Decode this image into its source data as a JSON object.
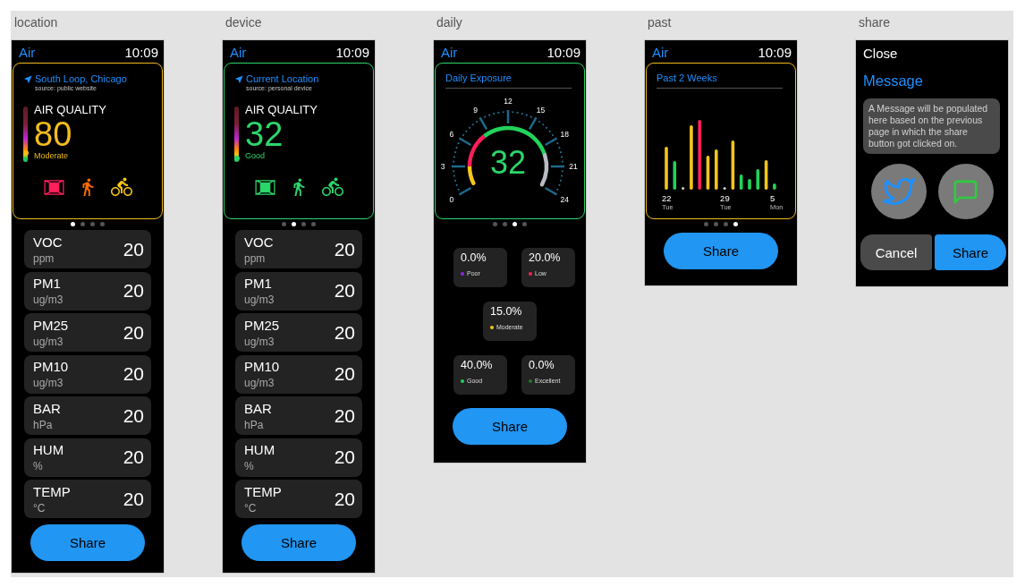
{
  "artboards": [
    {
      "kind": "overview",
      "label": "location",
      "status_bar": {
        "app": "Air",
        "time": "10:09"
      },
      "card": {
        "color": "#f2bc1b",
        "place": "South Loop, Chicago",
        "source": "source: public website",
        "heading": "AIR QUALITY",
        "value": "80",
        "rating": "Moderate",
        "level": 0.16,
        "activities": [
          {
            "kind": "indoor",
            "color": "#ff1f5a"
          },
          {
            "kind": "walk",
            "color": "#ff6a00"
          },
          {
            "kind": "bike",
            "color": "#f5c518"
          }
        ]
      },
      "pages": [
        {
          "selected": true
        },
        {
          "selected": false
        },
        {
          "selected": false
        },
        {
          "selected": false
        }
      ],
      "metrics": [
        {
          "name": "VOC",
          "unit": "ppm",
          "value": "20"
        },
        {
          "name": "PM1",
          "unit": "ug/m3",
          "value": "20"
        },
        {
          "name": "PM25",
          "unit": "ug/m3",
          "value": "20"
        },
        {
          "name": "PM10",
          "unit": "ug/m3",
          "value": "20"
        },
        {
          "name": "BAR",
          "unit": "hPa",
          "value": "20"
        },
        {
          "name": "HUM",
          "unit": "%",
          "value": "20"
        },
        {
          "name": "TEMP",
          "unit": "°C",
          "value": "20"
        }
      ],
      "share_button": "Share"
    },
    {
      "kind": "overview",
      "label": "device",
      "status_bar": {
        "app": "Air",
        "time": "10:09"
      },
      "card": {
        "color": "#2bd66b",
        "place": "Current Location",
        "source": "source: personal device",
        "heading": "AIR QUALITY",
        "value": "32",
        "rating": "Good",
        "level": 0.064,
        "activities": [
          {
            "kind": "indoor",
            "color": "#2bd66b"
          },
          {
            "kind": "walk",
            "color": "#2bd66b"
          },
          {
            "kind": "bike",
            "color": "#2bd66b"
          }
        ]
      },
      "pages": [
        {
          "selected": false
        },
        {
          "selected": true
        },
        {
          "selected": false
        },
        {
          "selected": false
        }
      ],
      "metrics": [
        {
          "name": "VOC",
          "unit": "ppm",
          "value": "20"
        },
        {
          "name": "PM1",
          "unit": "ug/m3",
          "value": "20"
        },
        {
          "name": "PM25",
          "unit": "ug/m3",
          "value": "20"
        },
        {
          "name": "PM10",
          "unit": "ug/m3",
          "value": "20"
        },
        {
          "name": "BAR",
          "unit": "hPa",
          "value": "20"
        },
        {
          "name": "HUM",
          "unit": "%",
          "value": "20"
        },
        {
          "name": "TEMP",
          "unit": "°C",
          "value": "20"
        }
      ],
      "share_button": "Share"
    },
    {
      "kind": "daily",
      "label": "daily",
      "status_bar": {
        "app": "Air",
        "time": "10:09"
      },
      "card": {
        "color": "#2bd66b",
        "title": "Daily Exposure",
        "value": "32",
        "ticks": [
          "0",
          "3",
          "6",
          "9",
          "12",
          "15",
          "18",
          "21",
          "24"
        ]
      },
      "pages": [
        {
          "selected": false
        },
        {
          "selected": false
        },
        {
          "selected": true
        },
        {
          "selected": false
        }
      ],
      "shares": [
        {
          "percent": "0.0%",
          "label": "Poor",
          "color": "#8a2be2"
        },
        {
          "percent": "20.0%",
          "label": "Low",
          "color": "#ff1f5a"
        },
        {
          "percent": "15.0%",
          "label": "Moderate",
          "color": "#f5c518"
        },
        {
          "percent": "40.0%",
          "label": "Good",
          "color": "#22d35a"
        },
        {
          "percent": "0.0%",
          "label": "Excellent",
          "color": "#1f7a1f"
        }
      ],
      "share_button": "Share"
    },
    {
      "kind": "history",
      "label": "past",
      "status_bar": {
        "app": "Air",
        "time": "10:09"
      },
      "card": {
        "color": "#f2bc1b",
        "title": "Past 2 Weeks",
        "axis_labels": [
          {
            "day": "22",
            "weekday": "Tue"
          },
          {
            "day": "29",
            "weekday": "Tue"
          },
          {
            "day": "5",
            "weekday": "Mon"
          }
        ]
      },
      "pages": [
        {
          "selected": false
        },
        {
          "selected": false
        },
        {
          "selected": false
        },
        {
          "selected": true
        }
      ],
      "share_button": "Share"
    },
    {
      "kind": "share",
      "label": "share",
      "close": "Close",
      "title": "Message",
      "message": "A Message will be populated here based on the previous page in which the share button got clicked on.",
      "targets": [
        {
          "kind": "bird"
        },
        {
          "kind": "chat"
        }
      ],
      "buttons": [
        {
          "kind": "cancel",
          "label": "Cancel"
        },
        {
          "kind": "confirm",
          "label": "Share"
        }
      ]
    }
  ]
}
